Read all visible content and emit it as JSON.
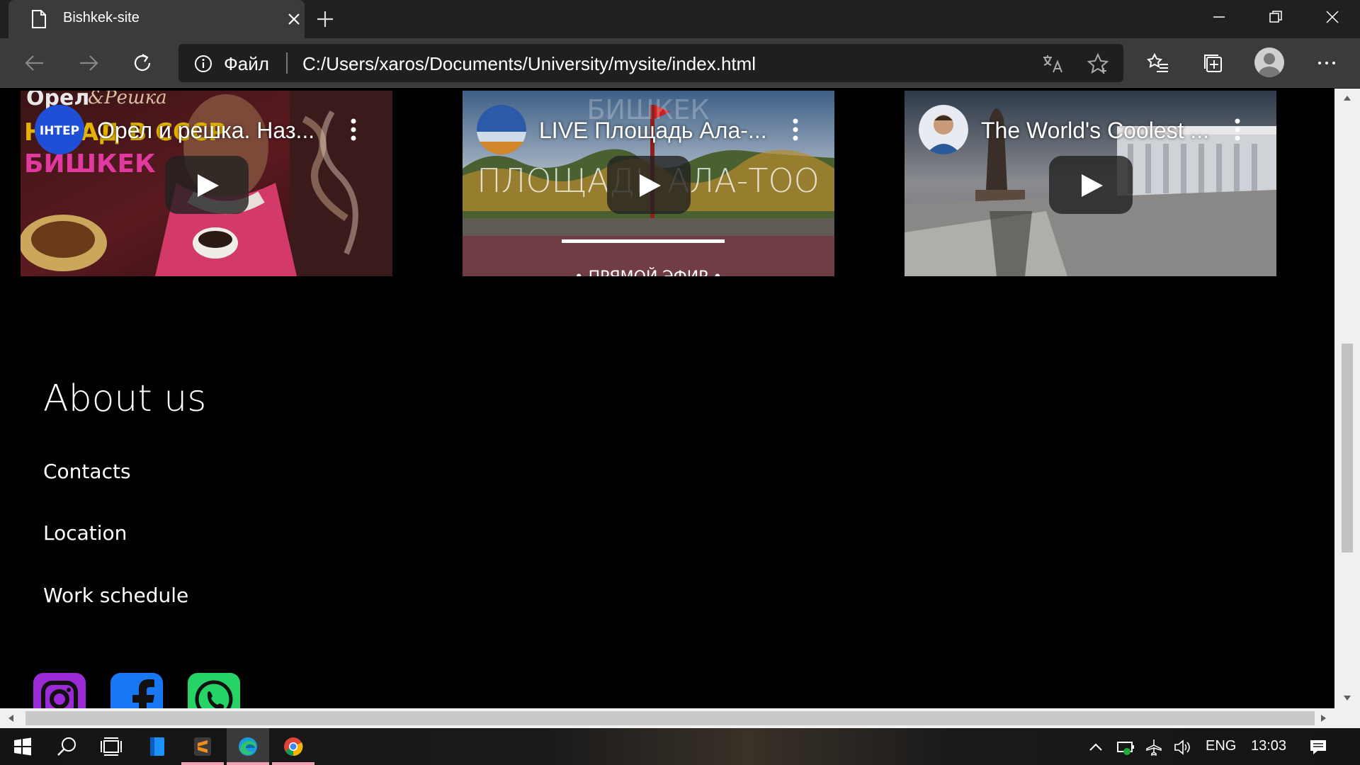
{
  "browser": {
    "tab_title": "Bishkek-site",
    "scheme_label": "Файл",
    "url": "C:/Users/xaros/Documents/University/mysite/index.html"
  },
  "videos": [
    {
      "title": "Орел и решка. Наз...",
      "channel": "ІНТЕР",
      "thumb_text_1": "Орел",
      "thumb_text_2": "&Решка",
      "thumb_text_3": "НАЗАД В СССР",
      "thumb_text_4": "БИШКЕК"
    },
    {
      "title": "LIVE Площадь Ала-...",
      "thumb_text_1": "БИШКЕК",
      "thumb_text_2": "ПЛОЩАДЬ АЛА-ТОО",
      "thumb_text_3": "• ПРЯМОЙ ЭФИР •"
    },
    {
      "title": "The World's Coolest ..."
    }
  ],
  "about": {
    "title": "About us",
    "links": [
      "Contacts",
      "Location",
      "Work schedule"
    ]
  },
  "social": [
    "instagram-icon",
    "facebook-icon",
    "whatsapp-icon"
  ],
  "taskbar": {
    "language": "ENG",
    "time": "13:03"
  },
  "colors": {
    "instagram": "#9b2bd6",
    "facebook": "#1877f2",
    "whatsapp": "#25d366",
    "page_bg": "#000000"
  }
}
